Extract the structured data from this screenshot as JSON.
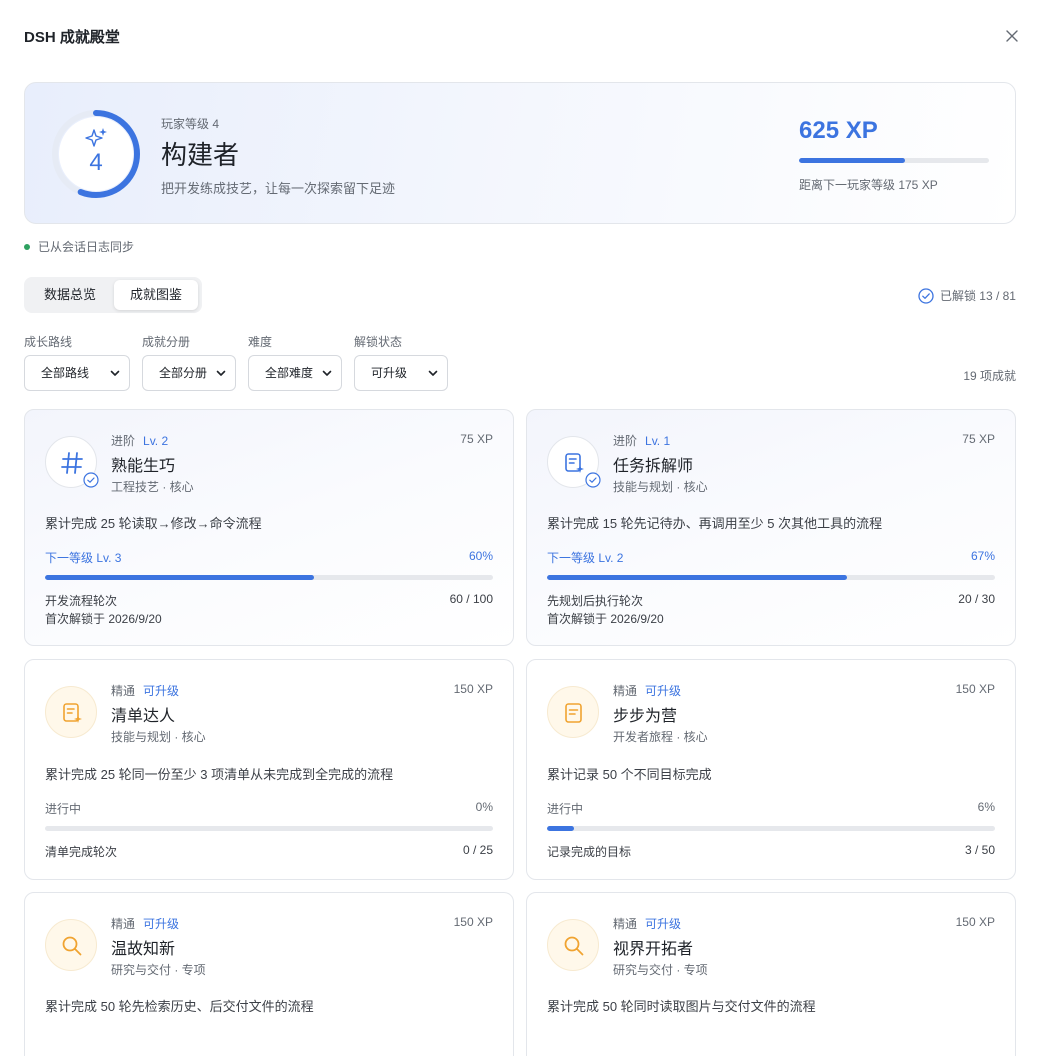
{
  "dialog": {
    "title": "DSH 成就殿堂"
  },
  "hero": {
    "level": "4",
    "level_label": "玩家等级 4",
    "rank_name": "构建者",
    "tagline": "把开发练成技艺，让每一次探索留下足迹",
    "xp": "625 XP",
    "xp_progress": 0.56,
    "next_level_text": "距离下一玩家等级 175 XP"
  },
  "sync_status": "已从会话日志同步",
  "tabs": [
    {
      "label": "数据总览",
      "active": false
    },
    {
      "label": "成就图鉴",
      "active": true
    }
  ],
  "unlocked_text": "已解锁 13 / 81",
  "filters": [
    {
      "label": "成长路线",
      "value": "全部路线"
    },
    {
      "label": "成就分册",
      "value": "全部分册"
    },
    {
      "label": "难度",
      "value": "全部难度"
    },
    {
      "label": "解锁状态",
      "value": "可升级"
    }
  ],
  "count_text": "19 项成就",
  "colors": {
    "accent": "#3c74e0",
    "orange": "#f0a330",
    "success": "#2ea160"
  },
  "cards": [
    {
      "icon": "hash-icon",
      "style": "blue",
      "tier": "进阶",
      "tag": "Lv. 2",
      "xp": "75 XP",
      "name": "熟能生巧",
      "category": "工程技艺 · 核心",
      "desc": "累计完成 25 轮读取→修改→命令流程",
      "progress_label": "下一等级 Lv. 3",
      "percent": "60%",
      "progress": 0.6,
      "metric": "开发流程轮次",
      "metric_value": "60 / 100",
      "first_unlock": "首次解锁于 2026/9/20"
    },
    {
      "icon": "task-plan-icon",
      "style": "blue",
      "tier": "进阶",
      "tag": "Lv. 1",
      "xp": "75 XP",
      "name": "任务拆解师",
      "category": "技能与规划 · 核心",
      "desc": "累计完成 15 轮先记待办、再调用至少 5 次其他工具的流程",
      "progress_label": "下一等级 Lv. 2",
      "percent": "67%",
      "progress": 0.67,
      "metric": "先规划后执行轮次",
      "metric_value": "20 / 30",
      "first_unlock": "首次解锁于 2026/9/20"
    },
    {
      "icon": "checklist-icon",
      "style": "orange",
      "tier": "精通",
      "tag": "可升级",
      "xp": "150 XP",
      "name": "清单达人",
      "category": "技能与规划 · 核心",
      "desc": "累计完成 25 轮同一份至少 3 项清单从未完成到全完成的流程",
      "progress_label": "进行中",
      "percent": "0%",
      "progress": 0.0,
      "metric": "清单完成轮次",
      "metric_value": "0 / 25"
    },
    {
      "icon": "document-icon",
      "style": "orange",
      "tier": "精通",
      "tag": "可升级",
      "xp": "150 XP",
      "name": "步步为营",
      "category": "开发者旅程 · 核心",
      "desc": "累计记录 50 个不同目标完成",
      "progress_label": "进行中",
      "percent": "6%",
      "progress": 0.06,
      "metric": "记录完成的目标",
      "metric_value": "3 / 50"
    },
    {
      "icon": "search-icon",
      "style": "orange",
      "tier": "精通",
      "tag": "可升级",
      "xp": "150 XP",
      "name": "温故知新",
      "category": "研究与交付 · 专项",
      "desc": "累计完成 50 轮先检索历史、后交付文件的流程"
    },
    {
      "icon": "search-icon",
      "style": "orange",
      "tier": "精通",
      "tag": "可升级",
      "xp": "150 XP",
      "name": "视界开拓者",
      "category": "研究与交付 · 专项",
      "desc": "累计完成 50 轮同时读取图片与交付文件的流程"
    }
  ]
}
